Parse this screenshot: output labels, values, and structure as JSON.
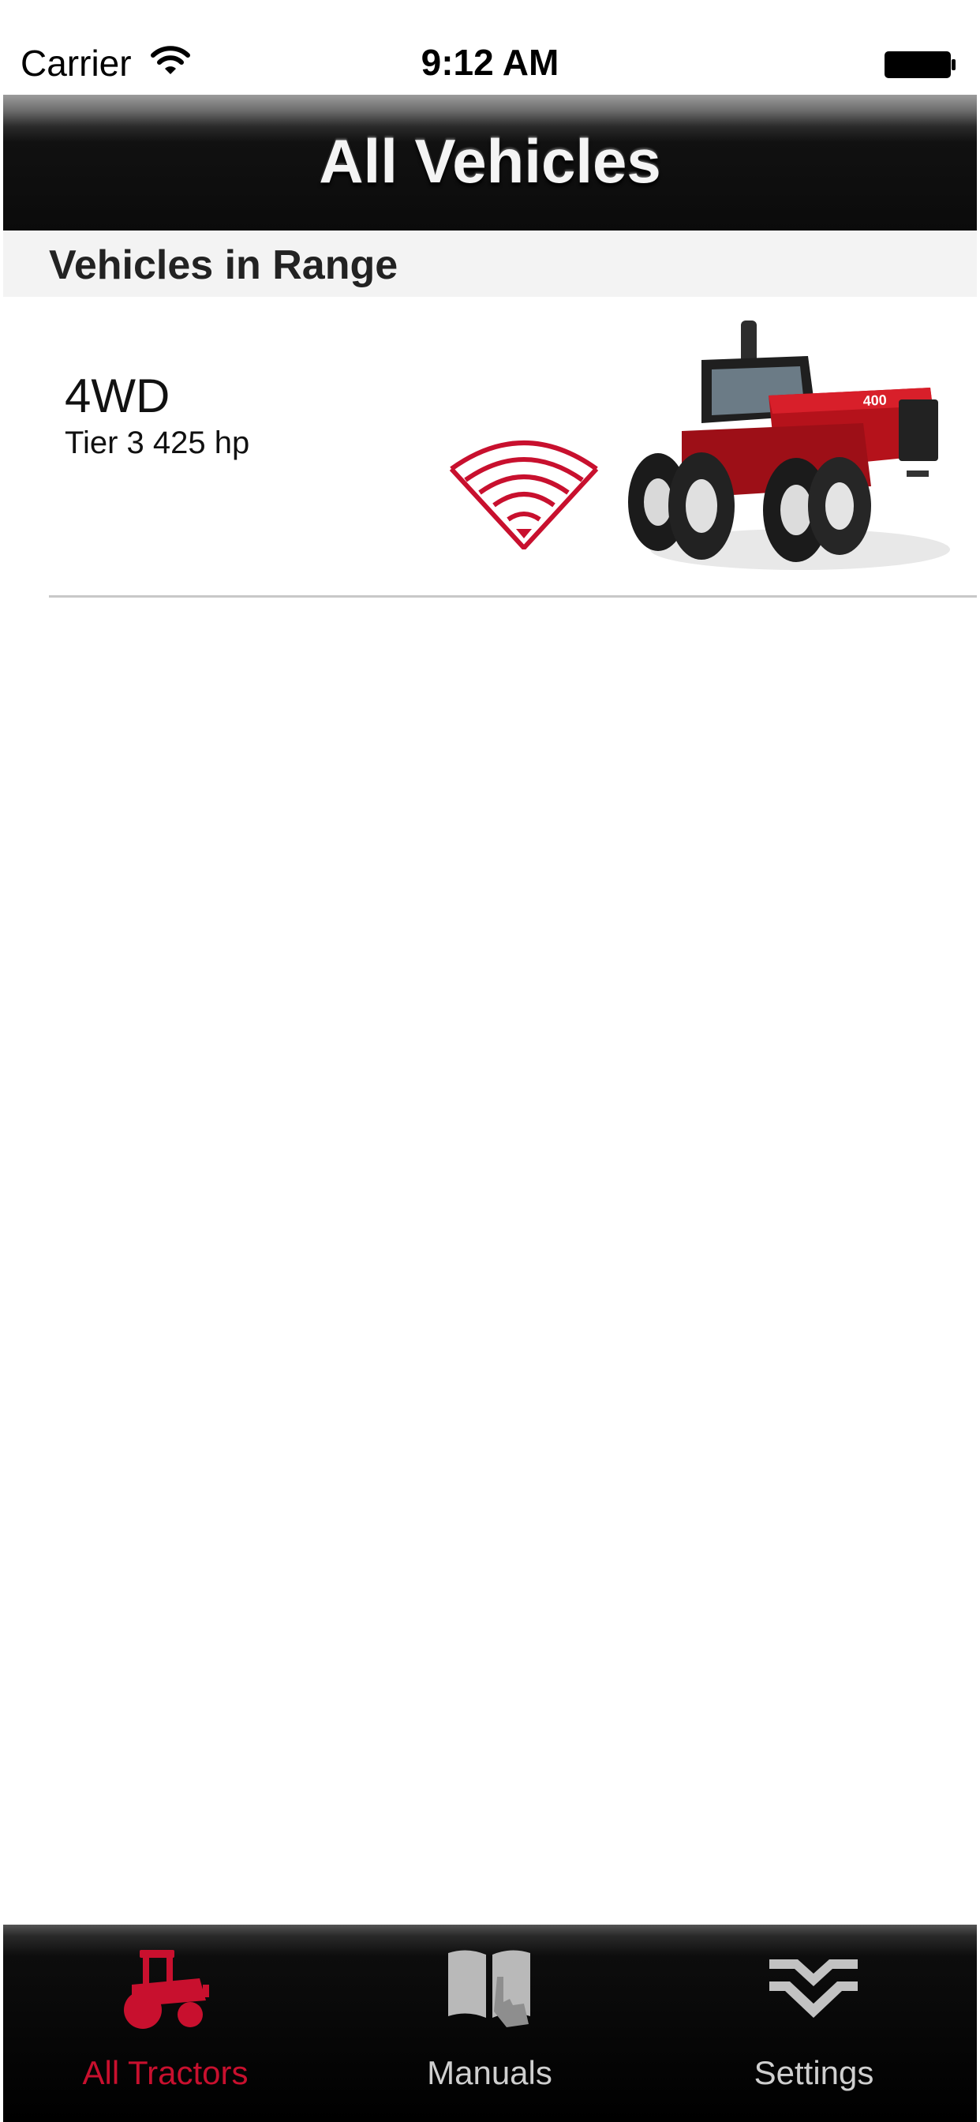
{
  "status_bar": {
    "carrier": "Carrier",
    "time": "9:12 AM",
    "wifi_icon": "wifi-icon",
    "battery_icon": "battery-icon"
  },
  "nav_bar": {
    "title": "All Vehicles"
  },
  "section": {
    "title": "Vehicles in Range"
  },
  "vehicles": [
    {
      "name": "4WD",
      "subtitle": "Tier 3 425 hp",
      "signal_icon": "signal-range-icon",
      "image": "tractor-image"
    }
  ],
  "tab_bar": {
    "tabs": [
      {
        "label": "All Tractors",
        "icon": "tractor-icon",
        "selected": true
      },
      {
        "label": "Manuals",
        "icon": "manual-book-icon",
        "selected": false
      },
      {
        "label": "Settings",
        "icon": "settings-logo-icon",
        "selected": false
      }
    ]
  },
  "colors": {
    "accent": "#c8102e",
    "tab_inactive": "#c8c8c8",
    "nav_background": "#0b0b0b"
  }
}
